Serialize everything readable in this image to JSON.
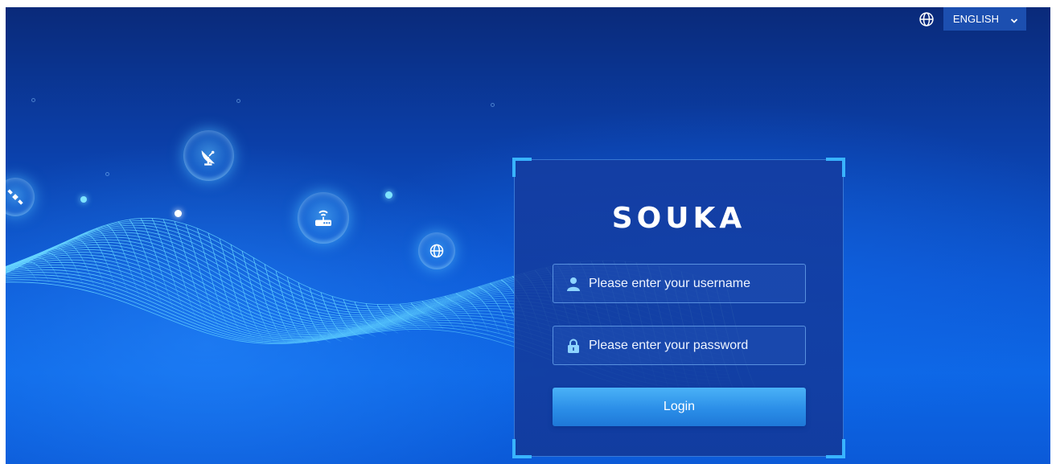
{
  "header": {
    "language_icon": "globe-icon",
    "language_label": "ENGLISH",
    "language_chevron": "chevron-down-icon"
  },
  "login": {
    "brand": "SOUKA",
    "username_placeholder": "Please enter your username",
    "username_icon": "user-icon",
    "password_placeholder": "Please enter your password",
    "password_icon": "lock-icon",
    "login_label": "Login"
  },
  "decor": {
    "icons": [
      "satellite-icon",
      "satellite-dish-icon",
      "router-icon",
      "globe-icon"
    ]
  },
  "colors": {
    "background_top": "#0a2a7a",
    "background_bottom": "#0d67e6",
    "accent": "#39b4ff",
    "button": "#2b8ee8"
  }
}
